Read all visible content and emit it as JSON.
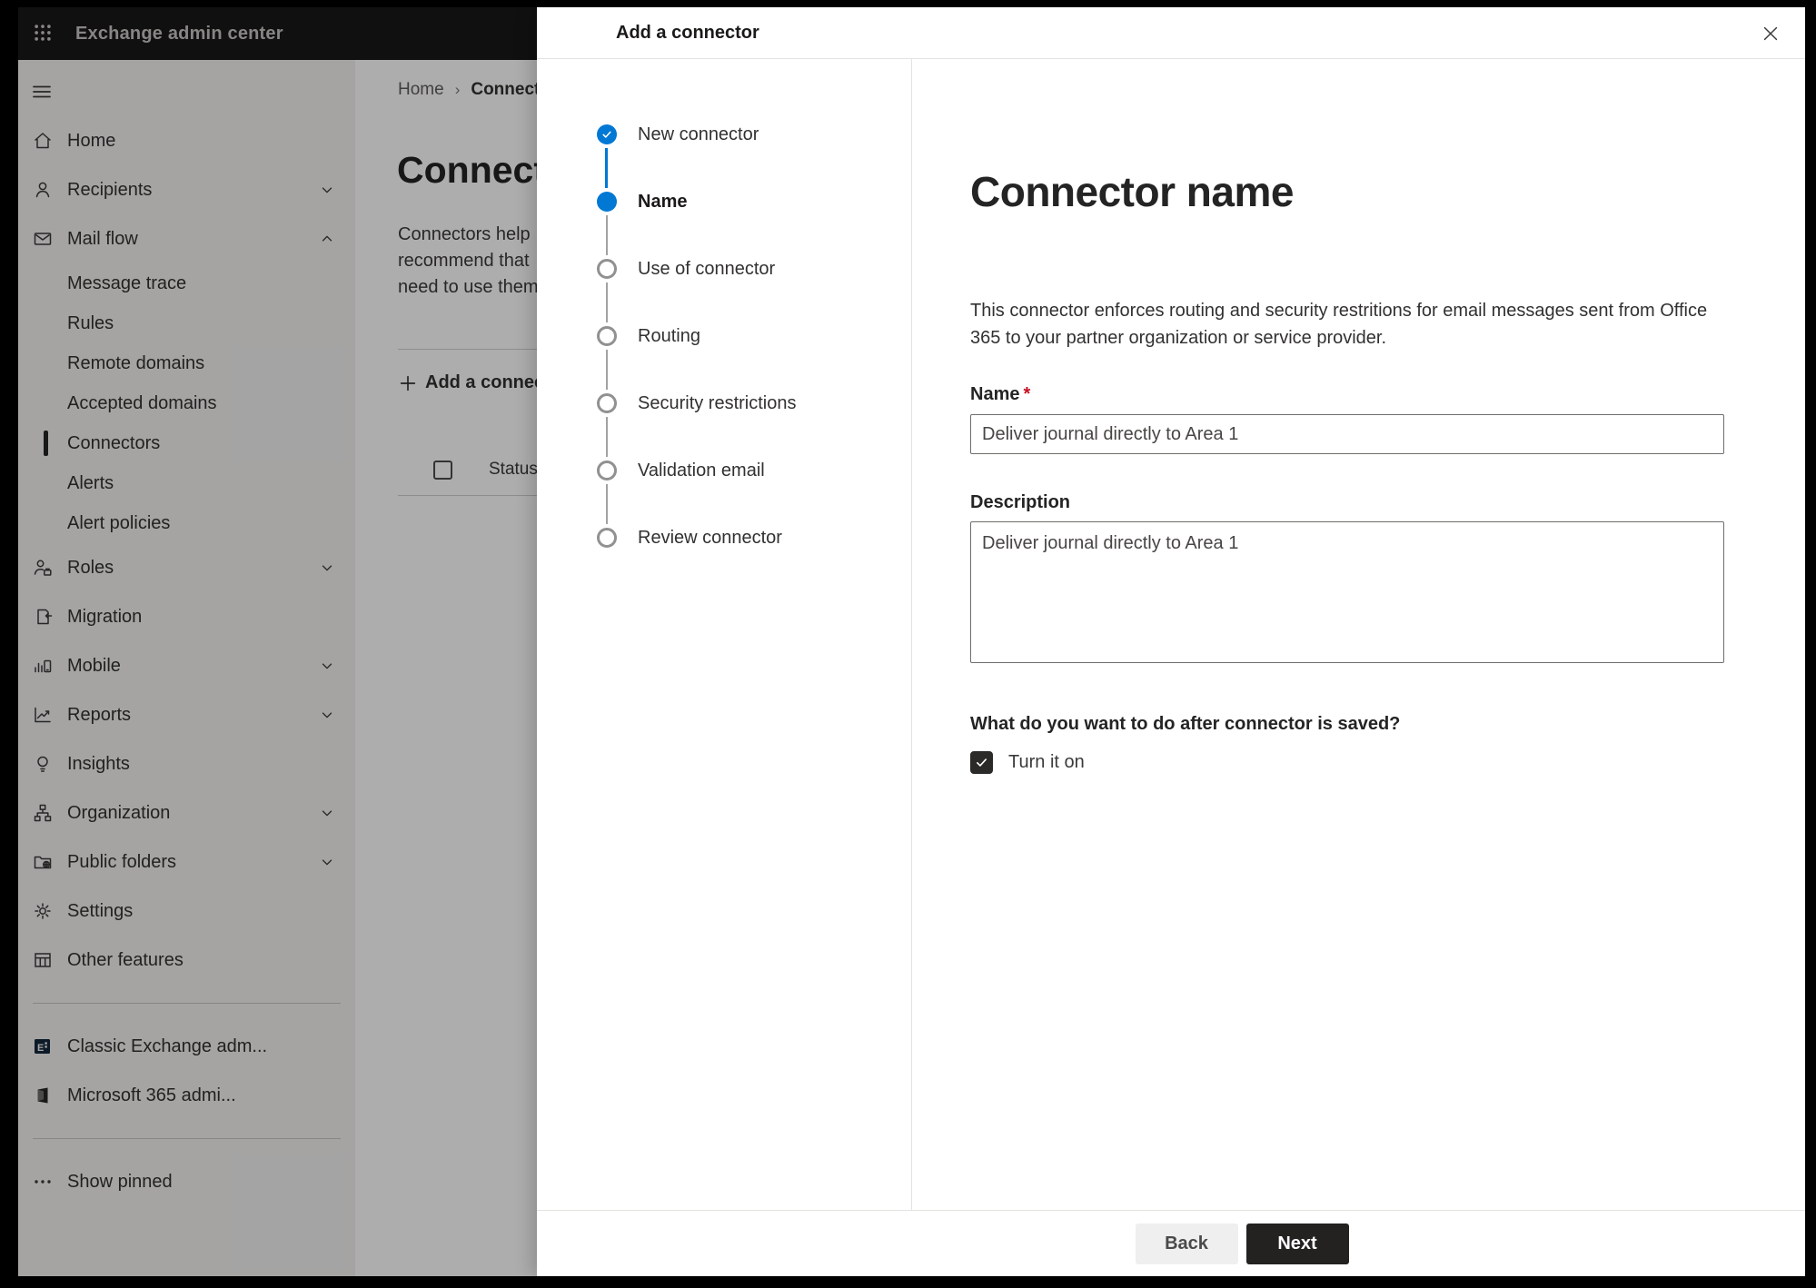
{
  "app": {
    "title": "Exchange admin center"
  },
  "colors": {
    "accent": "#0078d4",
    "topbar_bg": "#1a1918",
    "required_marker": "#c50f1f",
    "next_button_bg": "#232221",
    "selected_indicator": "#242424"
  },
  "sidebar": {
    "items": [
      {
        "label": "Home",
        "icon": "home",
        "level": 1
      },
      {
        "label": "Recipients",
        "icon": "person",
        "level": 1,
        "chevron": "down"
      },
      {
        "label": "Mail flow",
        "icon": "mail",
        "level": 1,
        "chevron": "up"
      },
      {
        "label": "Message trace",
        "level": 2
      },
      {
        "label": "Rules",
        "level": 2
      },
      {
        "label": "Remote domains",
        "level": 2
      },
      {
        "label": "Accepted domains",
        "level": 2
      },
      {
        "label": "Connectors",
        "level": 2,
        "selected": true
      },
      {
        "label": "Alerts",
        "level": 2
      },
      {
        "label": "Alert policies",
        "level": 2
      },
      {
        "label": "Roles",
        "icon": "roles",
        "level": 1,
        "chevron": "down"
      },
      {
        "label": "Migration",
        "icon": "migration",
        "level": 1
      },
      {
        "label": "Mobile",
        "icon": "mobile",
        "level": 1,
        "chevron": "down"
      },
      {
        "label": "Reports",
        "icon": "reports",
        "level": 1,
        "chevron": "down"
      },
      {
        "label": "Insights",
        "icon": "insights",
        "level": 1
      },
      {
        "label": "Organization",
        "icon": "organization",
        "level": 1,
        "chevron": "down"
      },
      {
        "label": "Public folders",
        "icon": "public-folders",
        "level": 1,
        "chevron": "down"
      },
      {
        "label": "Settings",
        "icon": "settings",
        "level": 1
      },
      {
        "label": "Other features",
        "icon": "other-features",
        "level": 1
      },
      {
        "divider": true
      },
      {
        "label": "Classic Exchange adm...",
        "icon": "exchange-logo",
        "level": 1
      },
      {
        "label": "Microsoft 365 admi...",
        "icon": "m365-logo",
        "level": 1
      },
      {
        "divider": true
      },
      {
        "label": "Show pinned",
        "icon": "ellipsis",
        "level": 1
      }
    ]
  },
  "page": {
    "breadcrumb": [
      "Home",
      "Connectors"
    ],
    "title": "Connectors",
    "description_lines": [
      "Connectors help",
      "recommend that",
      "need to use them"
    ],
    "add_button_label": "Add a connector",
    "table_header": "Status"
  },
  "dialog": {
    "title": "Add a connector",
    "steps": [
      {
        "label": "New connector",
        "state": "completed"
      },
      {
        "label": "Name",
        "state": "current"
      },
      {
        "label": "Use of connector",
        "state": "upcoming"
      },
      {
        "label": "Routing",
        "state": "upcoming"
      },
      {
        "label": "Security restrictions",
        "state": "upcoming"
      },
      {
        "label": "Validation email",
        "state": "upcoming"
      },
      {
        "label": "Review connector",
        "state": "upcoming"
      }
    ],
    "content": {
      "title": "Connector name",
      "description": "This connector enforces routing and security restritions for email messages sent from Office 365 to your partner organization or service provider.",
      "name_label": "Name",
      "required_marker": "*",
      "name_value": "Deliver journal directly to Area 1",
      "description_label": "Description",
      "description_value": "Deliver journal directly to Area 1",
      "question": "What do you want to do after connector is saved?",
      "checkbox_label": "Turn it on",
      "checkbox_checked": true
    },
    "footer": {
      "back": "Back",
      "next": "Next"
    }
  }
}
